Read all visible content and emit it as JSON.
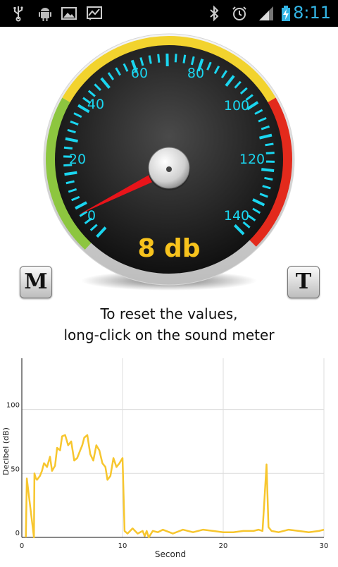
{
  "status_bar": {
    "time": "8:11",
    "icons": [
      "usb-icon",
      "android-debug-icon",
      "gallery-icon",
      "chart-notification-icon",
      "bluetooth-icon",
      "alarm-icon",
      "signal-icon",
      "battery-charging-icon"
    ]
  },
  "gauge": {
    "reading": "8 db",
    "scale_labels": [
      "0",
      "20",
      "40",
      "60",
      "80",
      "100",
      "120",
      "140"
    ],
    "needle_value": 8,
    "colors": {
      "needle": "#e8141a",
      "ticks": "#1ad6f0",
      "reading": "#f7c31d",
      "bezel_green": "#8dc63f",
      "bezel_yellow": "#f2d32e",
      "bezel_red": "#e32a1c"
    }
  },
  "buttons": {
    "m_label": "M",
    "t_label": "T"
  },
  "caption": {
    "line1": "To reset the values,",
    "line2": "long-click on the sound meter"
  },
  "chart_data": {
    "type": "line",
    "xlabel": "Second",
    "ylabel": "Decibel (dB)",
    "xlim": [
      0,
      30
    ],
    "ylim": [
      0,
      140
    ],
    "x_ticks": [
      "0",
      "10",
      "20",
      "30"
    ],
    "y_ticks": [
      "0",
      "50",
      "100"
    ],
    "grid": true,
    "color": "#f7c62e",
    "series": [
      {
        "x": [
          0.4,
          0.5,
          1.2,
          1.25,
          1.4,
          1.5,
          1.8,
          2.0,
          2.2,
          2.5,
          2.8,
          3.0,
          3.3,
          3.5,
          3.8,
          4.0,
          4.3,
          4.6,
          4.9,
          5.2,
          5.5,
          5.8,
          6.0,
          6.2,
          6.5,
          6.8,
          7.1,
          7.4,
          7.7,
          8.0,
          8.3,
          8.5,
          8.8,
          9.1,
          9.4,
          9.7,
          10.0,
          10.1,
          10.2,
          10.5,
          11.0,
          11.5,
          12.0,
          12.2,
          12.4,
          12.6,
          13.0,
          13.5,
          14.0,
          15.0,
          16.0,
          17.0,
          18.0,
          19.0,
          20.0,
          21.0,
          22.0,
          23.0,
          23.5,
          23.9,
          24.1,
          24.3,
          24.5,
          24.8,
          25.5,
          26.5,
          27.5,
          28.5,
          29.5,
          30.0
        ],
        "y": [
          0,
          46,
          0,
          50,
          46,
          45,
          48,
          52,
          58,
          55,
          63,
          52,
          56,
          70,
          68,
          79,
          80,
          72,
          75,
          60,
          62,
          68,
          72,
          78,
          80,
          65,
          60,
          72,
          68,
          58,
          55,
          45,
          48,
          62,
          55,
          58,
          62,
          35,
          5,
          3,
          7,
          3,
          5,
          1,
          5,
          0,
          5,
          4,
          6,
          3,
          6,
          4,
          6,
          5,
          4,
          4,
          5,
          5,
          6,
          5,
          30,
          57,
          8,
          5,
          4,
          6,
          5,
          4,
          5,
          6
        ]
      }
    ]
  }
}
